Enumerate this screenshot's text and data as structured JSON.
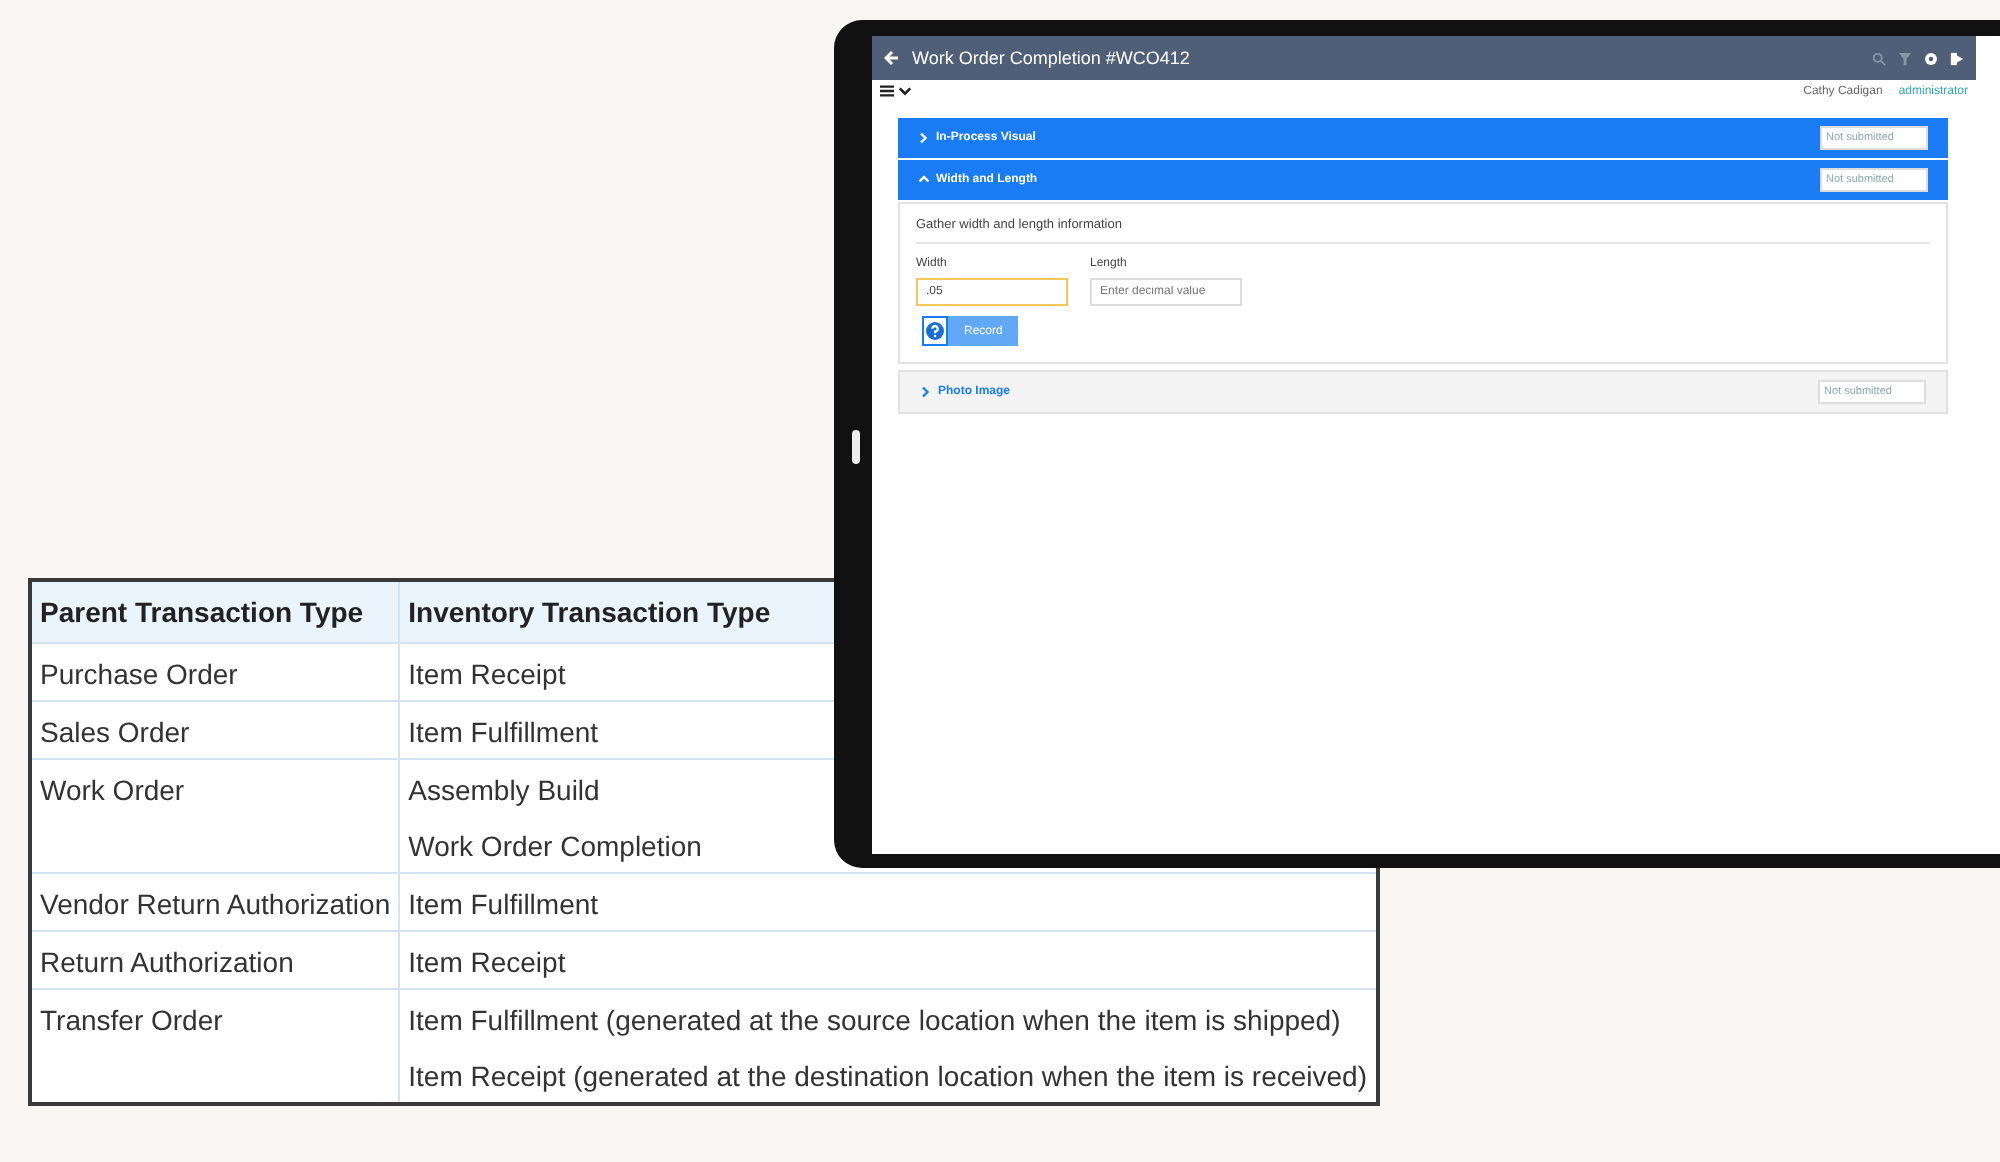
{
  "table": {
    "columns": [
      "Parent Transaction Type",
      "Inventory Transaction Type"
    ],
    "rows": [
      {
        "parent": "Purchase Order",
        "inventory": [
          "Item Receipt"
        ]
      },
      {
        "parent": "Sales Order",
        "inventory": [
          "Item Fulfillment"
        ]
      },
      {
        "parent": "Work Order",
        "inventory": [
          "Assembly Build",
          "Work Order Completion"
        ]
      },
      {
        "parent": "Vendor Return Authorization",
        "inventory": [
          "Item Fulfillment"
        ]
      },
      {
        "parent": "Return Authorization",
        "inventory": [
          "Item Receipt"
        ]
      },
      {
        "parent": "Transfer Order",
        "inventory": [
          "Item Fulfillment (generated at the source location when the item is shipped)",
          "Item Receipt (generated at the destination location when the item is received)"
        ]
      }
    ]
  },
  "tablet": {
    "title": "Work Order Completion #WCO412",
    "user": "Cathy Cadigan",
    "role": "administrator",
    "sections": [
      {
        "title": "In-Process Visual",
        "kind": "highlighted",
        "expanded": false,
        "status": "Not submitted"
      },
      {
        "title": "Width and Length",
        "kind": "highlighted",
        "expanded": true,
        "status": "Not submitted",
        "prompt": "Gather width and length information",
        "fields": [
          {
            "label": "Width",
            "value": ".05",
            "focused": true
          },
          {
            "label": "Length",
            "placeholder": "Enter decimal value",
            "focused": false
          }
        ],
        "button": "Record"
      },
      {
        "title": "Photo Image",
        "kind": "plain",
        "expanded": false,
        "status": "Not submitted"
      }
    ]
  }
}
